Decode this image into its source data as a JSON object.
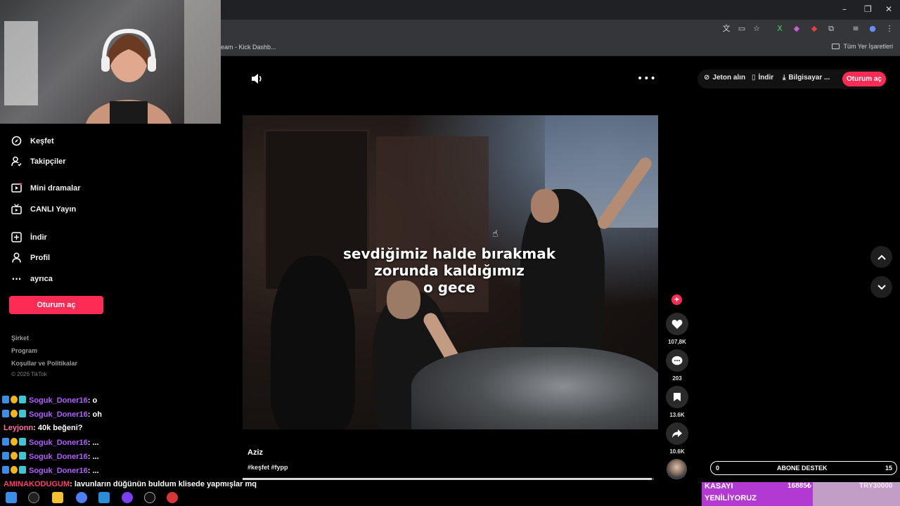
{
  "browser": {
    "tab_partial": "eam - Kick Dashb...",
    "bookmarks_right": "Tüm Yer İşaretleri",
    "window_controls": [
      "–",
      "❐",
      "✕"
    ]
  },
  "sidebar": {
    "items": [
      {
        "label": "Keşfet",
        "icon": "compass-icon"
      },
      {
        "label": "Takipçiler",
        "icon": "following-icon"
      },
      {
        "label": "Mini dramalar",
        "icon": "mini-drama-icon"
      },
      {
        "label": "CANLI Yayın",
        "icon": "live-tv-icon"
      },
      {
        "label": "İndir",
        "icon": "download-icon"
      },
      {
        "label": "Profil",
        "icon": "profile-icon"
      },
      {
        "label": "ayrıca",
        "icon": "more-icon"
      }
    ],
    "login_label": "Oturum aç",
    "footer": [
      "Şirket",
      "Program",
      "Koşullar ve Politikalar"
    ],
    "copyright": "© 2026 TikTok"
  },
  "header": {
    "coins": "Jeton alın",
    "download": "İndir",
    "computer": "Bilgisayar ...",
    "login": "Oturum aç"
  },
  "video": {
    "caption_lines": [
      "sevdiğimiz halde bırakmak",
      "zorunda kaldığımız",
      "o gece"
    ],
    "author": "Aziz",
    "hashtags": "#keşfet #fypp",
    "progress": 0.995
  },
  "actions": {
    "likes": "107,8K",
    "comments": "203",
    "saves": "13.6K",
    "shares": "10.6K"
  },
  "chat": [
    {
      "user": "Soguk_Doner16",
      "msg": ": o",
      "color": "purple",
      "badges": true
    },
    {
      "user": "Soguk_Doner16",
      "msg": ": oh",
      "color": "purple",
      "badges": true
    },
    {
      "user": "Leyjonn",
      "msg": ": 40k beğeni?",
      "color": "pink",
      "badges": false
    },
    {
      "user": "Soguk_Doner16",
      "msg": ": ...",
      "color": "purple",
      "badges": true
    },
    {
      "user": "Soguk_Doner16",
      "msg": ": ...",
      "color": "purple",
      "badges": true
    },
    {
      "user": "Soguk_Doner16",
      "msg": ": ...",
      "color": "purple",
      "badges": true
    },
    {
      "user": "AMINAKODUGUM",
      "msg": ": lavunların düğünün buldum klisede yapmışlar mq",
      "color": "red",
      "badges": false
    }
  ],
  "overlay": {
    "destek_left": "0",
    "destek_center": "ABONE DESTEK",
    "destek_right": "15",
    "kasa_line1": "KASAYI",
    "kasa_line2": "YENİLİYORUZ",
    "kasa_amount": "16885₺",
    "kasa_goal": "TRY30000"
  },
  "colors": {
    "accent": "#fe2c55",
    "chat_purple": "#b15cff",
    "chat_red": "#ff3d6e",
    "kasa": "#b23ad2"
  }
}
